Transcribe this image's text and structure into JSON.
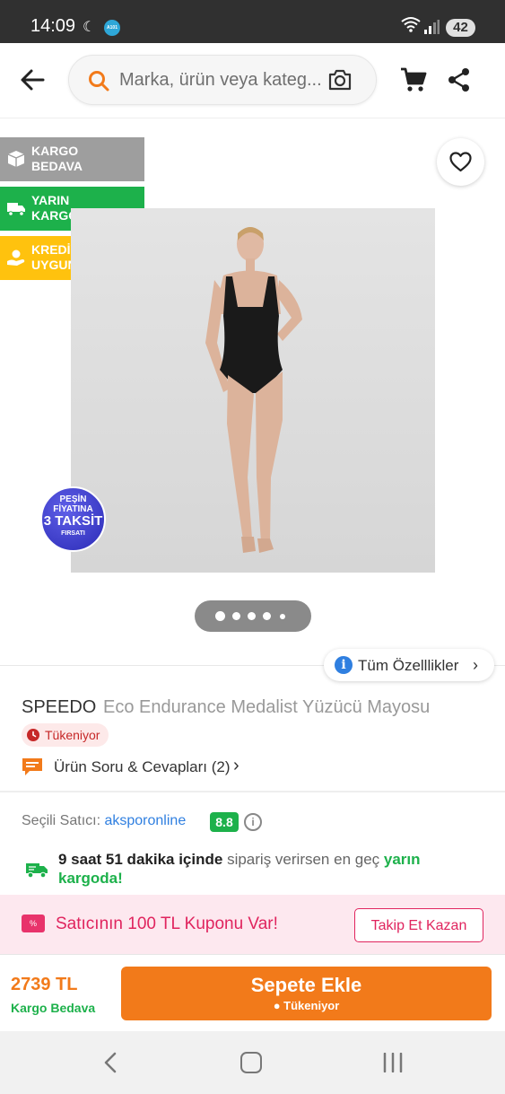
{
  "status_bar": {
    "time": "14:09",
    "app_badge": "A101",
    "battery": "42"
  },
  "header": {
    "search_placeholder": "Marka, ürün veya kateg...",
    "icons": [
      "back-arrow-icon",
      "search-icon",
      "camera-icon",
      "cart-icon",
      "share-icon"
    ]
  },
  "badges": [
    {
      "line1": "KARGO",
      "line2": "BEDAVA",
      "icon": "box-icon",
      "color": "#9e9e9e"
    },
    {
      "line1": "YARIN",
      "line2": "KARGODA",
      "icon": "truck-icon",
      "color": "#1db14b"
    },
    {
      "line1": "KREDİYE",
      "line2": "UYGUN",
      "icon": "hand-coin-icon",
      "color": "#ffc20e"
    }
  ],
  "promo_sticker": {
    "line1": "PEŞİN",
    "line2": "FİYATINA",
    "line3": "3 TAKSİT",
    "line4": "FIRSATI"
  },
  "gallery": {
    "image_count": 5,
    "active_index": 0
  },
  "all_features": {
    "label": "Tüm Özelllikler"
  },
  "product": {
    "brand": "SPEEDO",
    "name": "Eco Endurance Medalist Yüzücü Mayosu",
    "stock_status": "Tükeniyor",
    "qa_label": "Ürün Soru & Cevapları (2)"
  },
  "seller": {
    "label": "Seçili Satıcı:",
    "name": "aksporonline",
    "score": "8.8"
  },
  "delivery": {
    "time_text": "9 saat 51 dakika içinde",
    "middle_text": "sipariş verirsen en geç",
    "highlight": "yarın kargoda!"
  },
  "coupon": {
    "icon_text": "%",
    "text": "Satıcının 100 TL Kuponu Var!",
    "button": "Takip Et Kazan"
  },
  "purchase": {
    "price": "2739 TL",
    "shipping": "Kargo Bedava",
    "button_label": "Sepete Ekle",
    "button_sub": "Tükeniyor"
  },
  "colors": {
    "brand_orange": "#f27a1a",
    "green": "#1db14b",
    "pink": "#e0245e"
  }
}
